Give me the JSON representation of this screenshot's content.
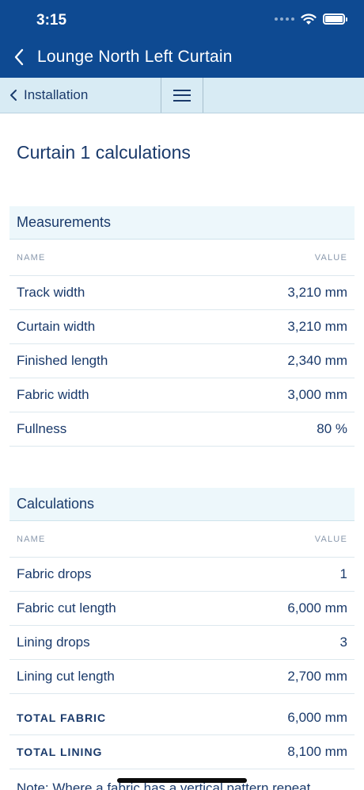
{
  "status": {
    "time": "3:15"
  },
  "nav": {
    "title": "Lounge North Left Curtain"
  },
  "subnav": {
    "back_label": "Installation"
  },
  "page": {
    "title": "Curtain 1 calculations"
  },
  "measurements": {
    "title": "Measurements",
    "col_name": "NAME",
    "col_value": "VALUE",
    "rows": [
      {
        "name": "Track width",
        "value": "3,210 mm"
      },
      {
        "name": "Curtain width",
        "value": "3,210 mm"
      },
      {
        "name": "Finished length",
        "value": "2,340 mm"
      },
      {
        "name": "Fabric width",
        "value": "3,000 mm"
      },
      {
        "name": "Fullness",
        "value": "80 %"
      }
    ]
  },
  "calculations": {
    "title": "Calculations",
    "col_name": "NAME",
    "col_value": "VALUE",
    "rows": [
      {
        "name": "Fabric drops",
        "value": "1"
      },
      {
        "name": "Fabric cut length",
        "value": "6,000 mm"
      },
      {
        "name": "Lining drops",
        "value": "3"
      },
      {
        "name": "Lining cut length",
        "value": "2,700 mm"
      }
    ],
    "totals": [
      {
        "name": "TOTAL FABRIC",
        "value": "6,000 mm"
      },
      {
        "name": "TOTAL LINING",
        "value": "8,100 mm"
      }
    ]
  },
  "note": {
    "text": "Note: Where a fabric has a vertical pattern repeat"
  },
  "colors": {
    "header_bg": "#0e4a92",
    "subnav_bg": "#d8ebf4",
    "section_bg": "#edf7fb",
    "text": "#1a3a6b"
  },
  "icons": {
    "back": "chevron-left-icon",
    "menu": "hamburger-menu-icon",
    "wifi": "wifi-icon",
    "battery": "battery-icon"
  }
}
